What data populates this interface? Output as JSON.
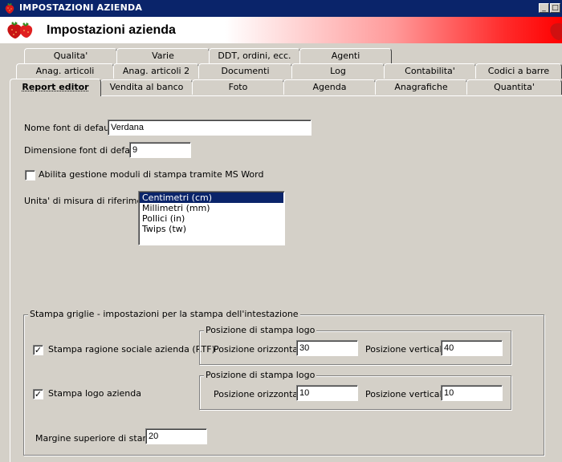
{
  "window": {
    "title": "IMPOSTAZIONI AZIENDA",
    "controls": {
      "minimize": "_",
      "maximize": "□"
    }
  },
  "header": {
    "title": "Impostazioni azienda"
  },
  "tabs": {
    "row1": [
      "Qualita'",
      "Varie",
      "DDT, ordini, ecc.",
      "Agenti"
    ],
    "row2": [
      "Anag. articoli",
      "Anag. articoli 2",
      "Documenti",
      "Log",
      "Contabilita'",
      "Codici a barre"
    ],
    "row3": [
      "Report editor",
      "Vendita al banco",
      "Foto",
      "Agenda",
      "Anagrafiche",
      "Quantita'"
    ],
    "active": "Report editor"
  },
  "form": {
    "font_name_label": "Nome font di default",
    "font_name_value": "Verdana",
    "font_size_label": "Dimensione font di default",
    "font_size_value": "9",
    "word_checkbox_label": "Abilita gestione moduli di stampa tramite MS Word",
    "word_checkbox_checked": false,
    "units_label": "Unita' di misura di riferimento",
    "units_options": [
      "Centimetri (cm)",
      "Millimetri (mm)",
      "Pollici (in)",
      "Twips (tw)"
    ],
    "units_selected": "Centimetri (cm)"
  },
  "print_group": {
    "legend": "Stampa griglie - impostazioni per la stampa dell'intestazione",
    "ragione_sociale": {
      "checkbox_label": "Stampa ragione sociale azienda (RTF)",
      "checked": true,
      "subgroup_legend": "Posizione di stampa logo",
      "horizontal_label": "Posizione orizzontale",
      "horizontal_value": "30",
      "vertical_label": "Posizione verticale",
      "vertical_value": "40"
    },
    "logo": {
      "checkbox_label": "Stampa logo azienda",
      "checked": true,
      "subgroup_legend": "Posizione di stampa logo",
      "horizontal_label": "Posizione orizzontale",
      "horizontal_value": "10",
      "vertical_label": "Posizione verticale",
      "vertical_value": "10"
    },
    "top_margin_label": "Margine superiore di stampa",
    "top_margin_value": "20"
  },
  "colors": {
    "titlebar": "#0a246a",
    "banner_end": "#ff0000",
    "selection": "#0a246a"
  },
  "icons": {
    "app": "strawberry-icon",
    "banner": "strawberries-icon",
    "check": "check-icon"
  }
}
